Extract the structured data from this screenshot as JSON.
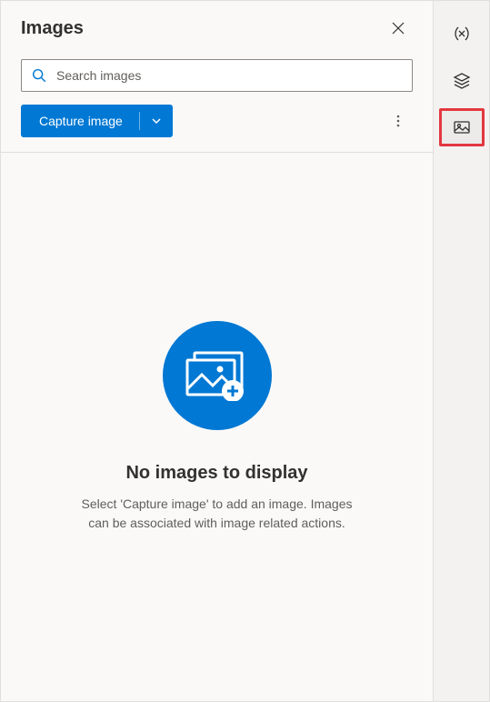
{
  "header": {
    "title": "Images"
  },
  "search": {
    "placeholder": "Search images"
  },
  "toolbar": {
    "capture_label": "Capture image"
  },
  "empty": {
    "title": "No images to display",
    "description": "Select 'Capture image' to add an image. Images can be associated with image related actions."
  },
  "colors": {
    "primary": "#0078d4",
    "highlight": "#e3373f"
  }
}
